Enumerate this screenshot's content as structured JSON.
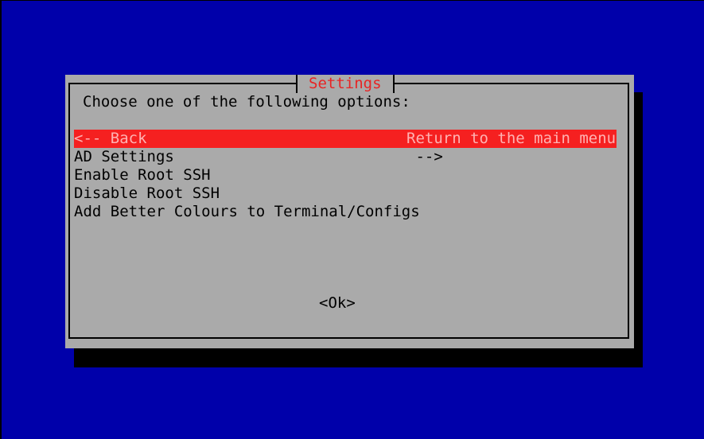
{
  "dialog": {
    "title": "Settings",
    "prompt": "Choose one of the following options:",
    "ok_label": "<Ok>"
  },
  "menu": {
    "items": [
      {
        "tag": "<-- Back",
        "desc": "Return to the main menu",
        "selected": true
      },
      {
        "tag": "AD Settings",
        "desc": " -->",
        "selected": false
      },
      {
        "tag": "Enable Root SSH",
        "desc": "",
        "selected": false
      },
      {
        "tag": "Disable Root SSH",
        "desc": "",
        "selected": false
      },
      {
        "tag": "Add Better Colours to Terminal/Configs",
        "desc": "",
        "selected": false
      }
    ]
  },
  "colors": {
    "background": "#0000AA",
    "dialog": "#AAAAAA",
    "title": "#E82424",
    "selection": "#F52020",
    "selection_text": "#FFB2B2"
  }
}
